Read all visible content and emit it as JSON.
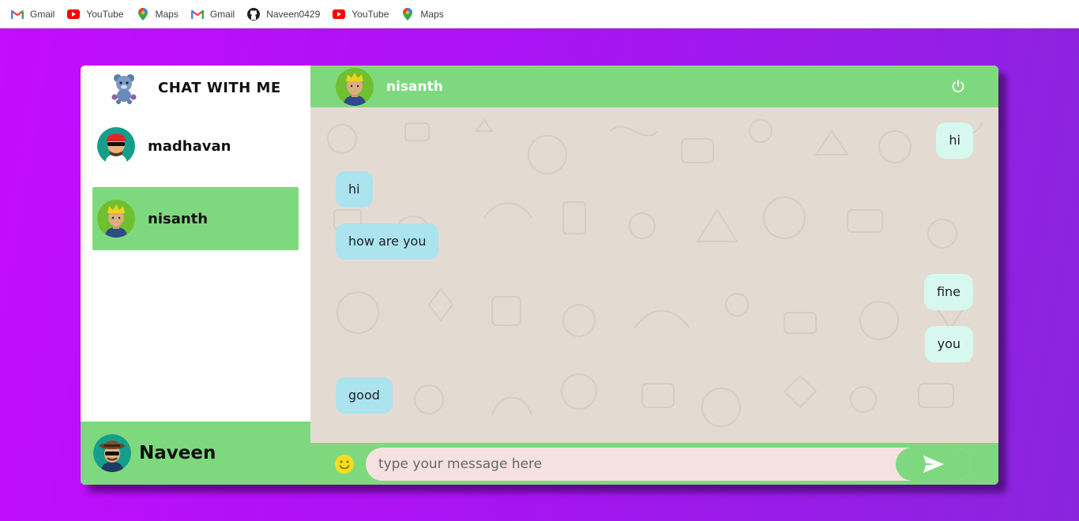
{
  "bookmarks": [
    {
      "label": "Gmail",
      "icon": "gmail-icon"
    },
    {
      "label": "YouTube",
      "icon": "youtube-icon"
    },
    {
      "label": "Maps",
      "icon": "maps-icon"
    },
    {
      "label": "Gmail",
      "icon": "gmail-icon"
    },
    {
      "label": "Naveen0429",
      "icon": "github-icon"
    },
    {
      "label": "YouTube",
      "icon": "youtube-icon"
    },
    {
      "label": "Maps",
      "icon": "maps-icon"
    }
  ],
  "sidebar": {
    "title": "CHAT WITH ME",
    "contacts": [
      {
        "name": "madhavan",
        "active": false
      },
      {
        "name": "nisanth",
        "active": true
      }
    ],
    "current_user": "Naveen"
  },
  "chat": {
    "contact_name": "nisanth",
    "messages": [
      {
        "text": "hi",
        "direction": "out"
      },
      {
        "text": "hi",
        "direction": "in"
      },
      {
        "text": "how are you",
        "direction": "in"
      },
      {
        "text": "fine",
        "direction": "out"
      },
      {
        "text": "you",
        "direction": "out"
      },
      {
        "text": "good",
        "direction": "in"
      }
    ],
    "input_placeholder": "type your message here"
  },
  "colors": {
    "accent_green": "#7ed97e",
    "background_purple": "#b316f0",
    "outgoing_bubble": "#d6f8ee",
    "incoming_bubble": "#abe3ef",
    "chat_background": "#e3dbd2",
    "input_background": "#f5e2e0"
  }
}
